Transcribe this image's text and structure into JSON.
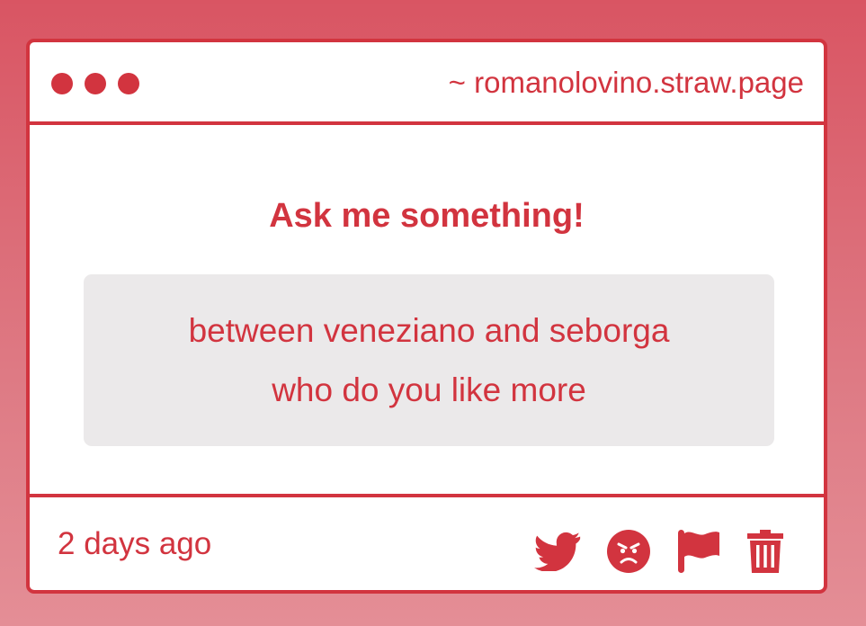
{
  "window": {
    "url": "~ romanolovino.straw.page"
  },
  "main": {
    "heading": "Ask me something!",
    "question_lines": [
      "between veneziano and seborga",
      "who do you like more"
    ]
  },
  "footer": {
    "timestamp": "2 days ago",
    "actions": [
      {
        "icon": "twitter-icon"
      },
      {
        "icon": "angry-face-icon"
      },
      {
        "icon": "flag-icon"
      },
      {
        "icon": "trash-icon"
      }
    ]
  },
  "colors": {
    "accent": "#d2343f",
    "background_top": "#d95563",
    "background_bottom": "#e48e96",
    "question_box": "#ebe9ea",
    "card": "#ffffff"
  }
}
